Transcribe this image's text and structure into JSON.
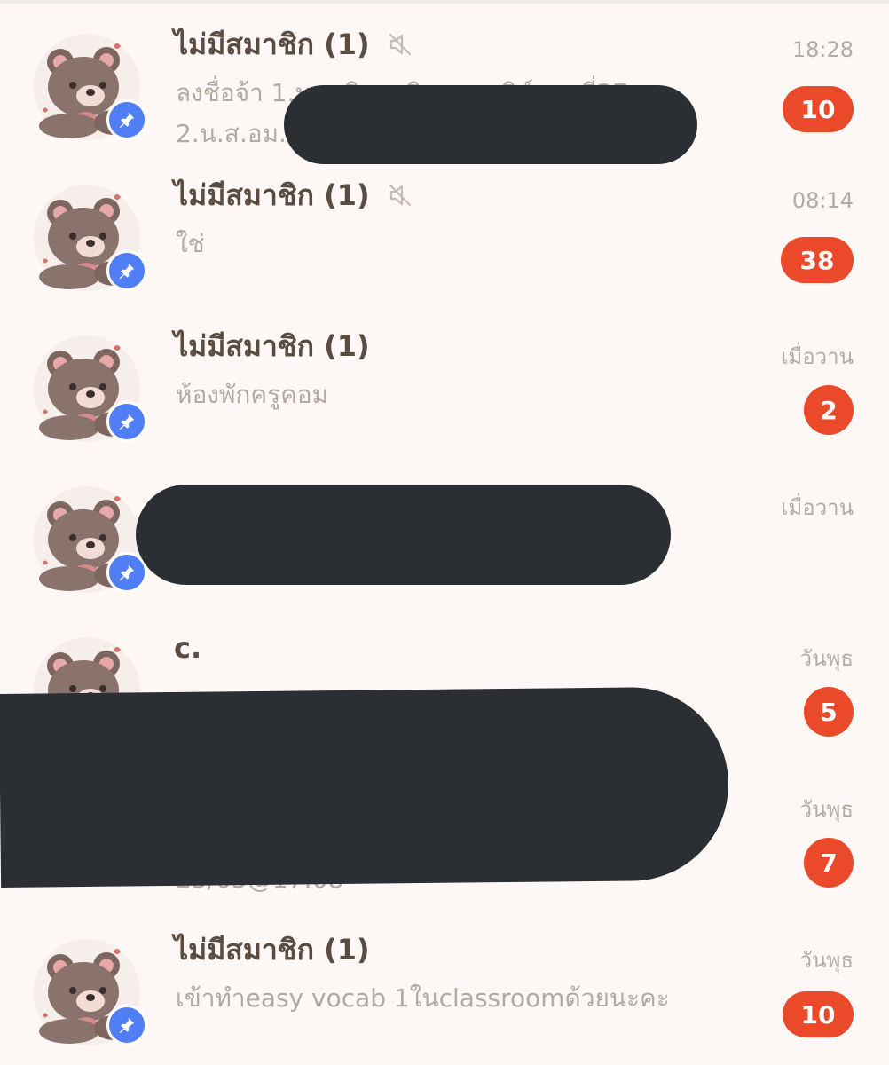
{
  "chats": [
    {
      "name": "ไม่มีสมาชิก (1)",
      "preview_line1": "ลงชื่อจ้า 1.น.ส.ชิญ...ชิณ.......ชิษ์......ที่27",
      "preview_line2": "2.น.ส.อม...ติ…",
      "time": "18:28",
      "unread": "10",
      "muted": true,
      "pinned": true
    },
    {
      "name": "ไม่มีสมาชิก (1)",
      "preview_line1": "ใช่",
      "time": "08:14",
      "unread": "38",
      "muted": true,
      "pinned": true
    },
    {
      "name": "ไม่มีสมาชิก (1)",
      "preview_line1": "ห้องพักครูคอม",
      "time": "เมื่อวาน",
      "unread": "2",
      "muted": false,
      "pinned": true
    },
    {
      "name": "",
      "preview_line1": "",
      "time": "เมื่อวาน",
      "muted": false,
      "pinned": true
    },
    {
      "name": "c.",
      "preview_line1": "",
      "time": "วันพุธ",
      "unread": "5",
      "muted": false,
      "pinned": true
    },
    {
      "name": "",
      "preview_line1": "",
      "preview_line2": "25/05@17:08",
      "time": "วันพุธ",
      "unread": "7",
      "muted": false,
      "pinned": true
    },
    {
      "name": "ไม่มีสมาชิก (1)",
      "preview_line1": "เข้าทำeasy vocab 1ในclassroomด้วยนะคะ",
      "time": "วันพุธ",
      "unread": "10",
      "muted": false,
      "pinned": true
    }
  ],
  "icons": {
    "pin": "pin-icon",
    "mute": "speaker-muted-icon",
    "avatar": "teddy-bear-avatar"
  },
  "colors": {
    "background": "#fdf8f5",
    "unread_badge": "#ea4a2a",
    "pin_badge": "#4f7ef6",
    "name_text": "#5b4c41",
    "preview_text": "#b4a9a1",
    "redaction": "#2b2e32"
  }
}
